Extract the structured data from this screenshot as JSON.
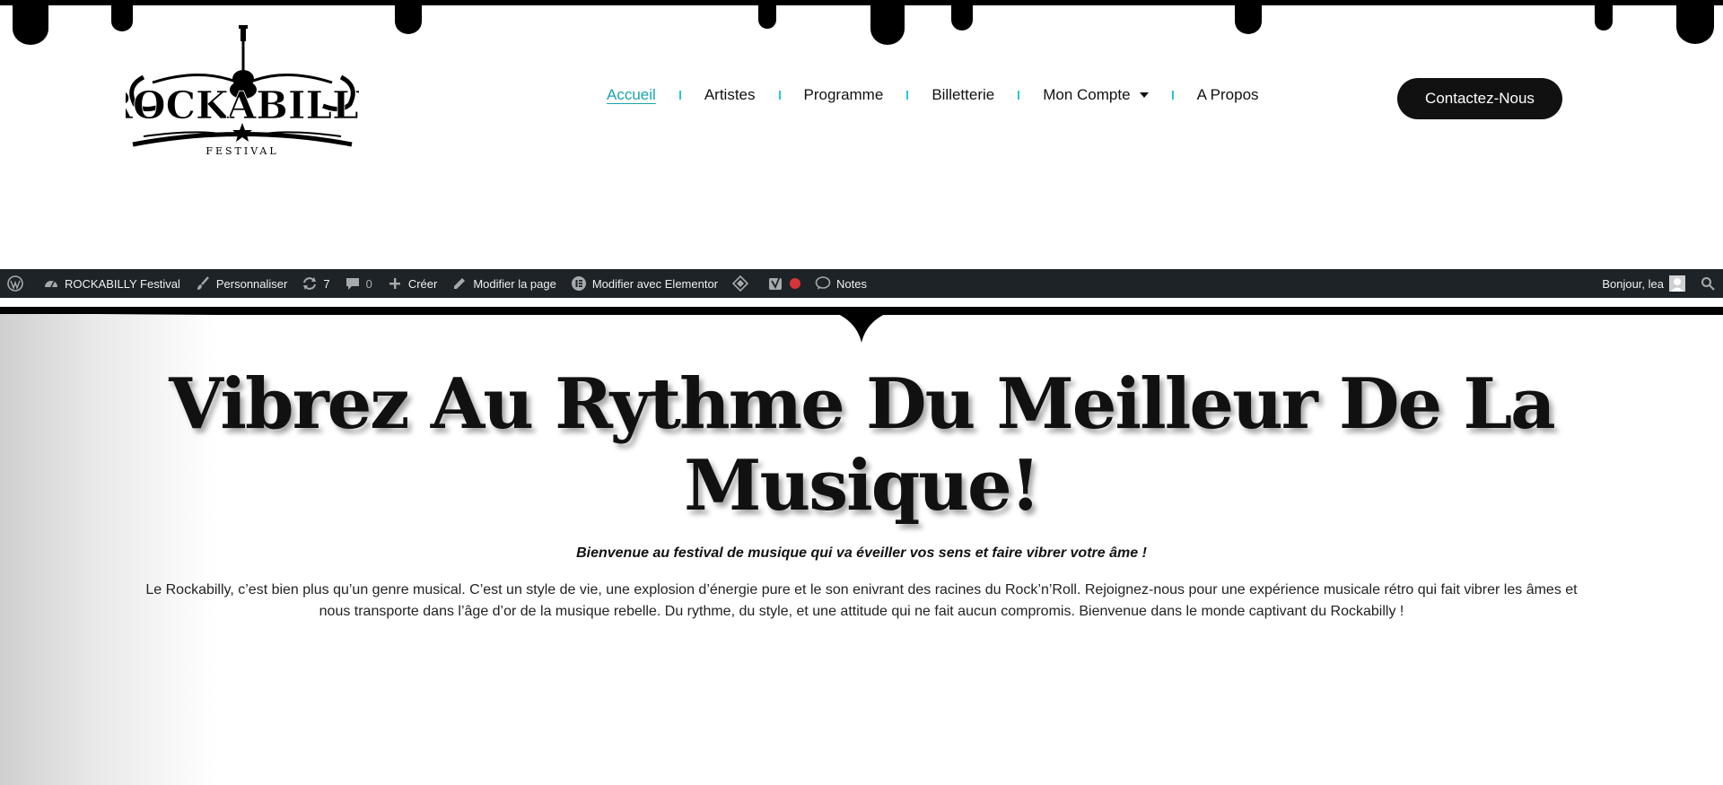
{
  "site": {
    "logo": {
      "word": "ROCKABILLY",
      "sub": "FESTIVAL"
    }
  },
  "nav": {
    "items": [
      {
        "label": "Accueil",
        "active": true
      },
      {
        "label": "Artistes",
        "active": false
      },
      {
        "label": "Programme",
        "active": false
      },
      {
        "label": "Billetterie",
        "active": false
      },
      {
        "label": "Mon Compte",
        "active": false,
        "dropdown": true
      },
      {
        "label": "A Propos",
        "active": false
      }
    ],
    "cta_label": "Contactez-Nous"
  },
  "adminbar": {
    "site_name": "ROCKABILLY Festival",
    "customize": "Personnaliser",
    "updates_count": "7",
    "comments_count": "0",
    "create": "Créer",
    "edit_page": "Modifier la page",
    "edit_elementor": "Modifier avec Elementor",
    "notes": "Notes",
    "greeting": "Bonjour, lea"
  },
  "hero": {
    "title": "Vibrez Au Rythme Du Meilleur De La Musique!",
    "subtitle": "Bienvenue au festival de musique qui va éveiller vos sens et faire vibrer votre âme !",
    "body": "Le Rockabilly, c’est bien plus qu’un genre musical. C’est un style de vie, une explosion d’énergie pure et le son enivrant des racines du Rock’n’Roll. Rejoignez-nous pour une expérience musicale rétro qui fait vibrer les âmes et nous transporte dans l’âge d’or de la musique rebelle. Du rythme, du style, et une attitude qui ne fait aucun compromis. Bienvenue dans le monde captivant du Rockabilly !"
  },
  "colors": {
    "accent": "#26c6da",
    "active_link": "#1aa3b5",
    "adminbar_bg": "#1d2327",
    "cta_bg": "#111111",
    "status_dot": "#d63638"
  }
}
